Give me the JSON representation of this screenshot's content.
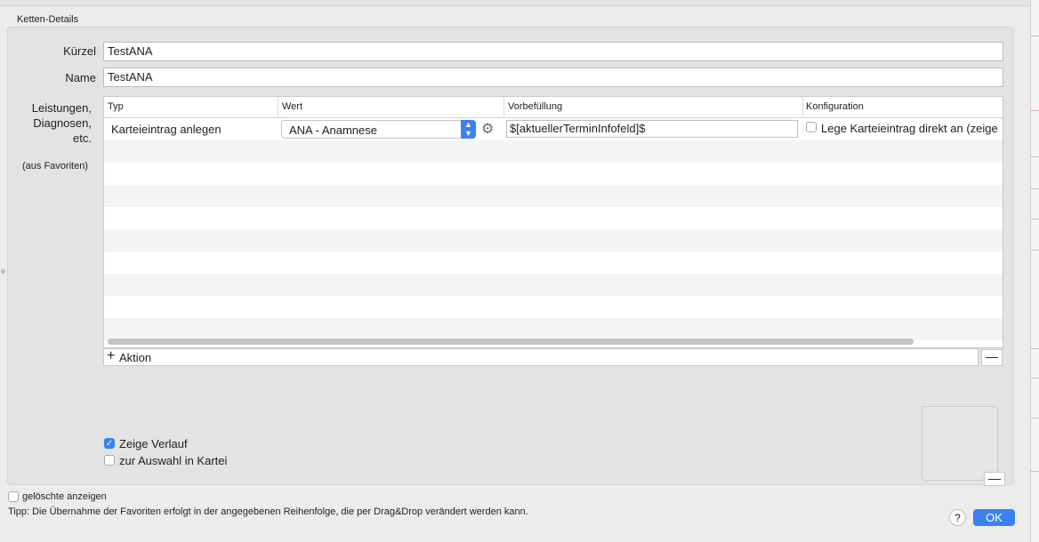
{
  "box_title": "Ketten-Details",
  "kuerzel": {
    "label": "Kürzel",
    "value": "TestANA"
  },
  "name": {
    "label": "Name",
    "value": "TestANA"
  },
  "leistungen": {
    "label_lines": [
      "Leistungen,",
      "Diagnosen,",
      "etc."
    ],
    "sub": "(aus Favoriten)"
  },
  "table": {
    "columns": [
      "Typ",
      "Wert",
      "Vorbefüllung",
      "Konfiguration"
    ],
    "rows": [
      {
        "typ": "Karteieintrag anlegen",
        "wert": "ANA - Anamnese",
        "vorbefuellung": "$[aktuellerTerminInfofeld]$",
        "konfiguration": "Lege Karteieintrag direkt an (zeige",
        "konfiguration_checked": false
      }
    ]
  },
  "actions": {
    "add_label": "Aktion",
    "plus_symbol": "+",
    "minus_symbol": "—"
  },
  "options": {
    "zeige_verlauf": {
      "label": "Zeige Verlauf",
      "checked": true
    },
    "zur_auswahl": {
      "label": "zur Auswahl in Kartei",
      "checked": false
    }
  },
  "geloeschte": {
    "label": "gelöschte anzeigen",
    "checked": false
  },
  "tipp": "Tipp: Die Übernahme der Favoriten erfolgt in der angegebenen Reihenfolge, die per Drag&Drop verändert werden kann.",
  "help_label": "?",
  "ok_label": "OK",
  "colors": {
    "accent": "#3b82f0"
  }
}
